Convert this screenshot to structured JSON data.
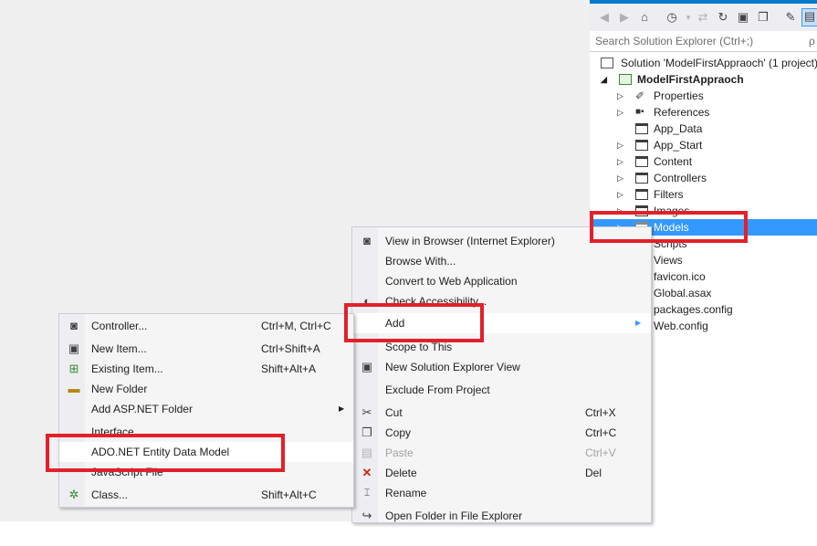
{
  "solution_explorer": {
    "search_placeholder": "Search Solution Explorer (Ctrl+;)",
    "search_arrow": "ρ",
    "toolbar_icons": [
      "back-icon",
      "forward-icon",
      "home-icon",
      "history-icon",
      "sync-icon",
      "refresh-icon",
      "collapse-all-icon",
      "copy-icon",
      "properties-icon",
      "preview-icon"
    ],
    "tree": {
      "solution": "Solution 'ModelFirstAppraoch' (1 project)",
      "project": "ModelFirstAppraoch",
      "items": [
        "Properties",
        "References",
        "App_Data",
        "App_Start",
        "Content",
        "Controllers",
        "Filters",
        "Images",
        "Models",
        "Scripts",
        "Views",
        "favicon.ico",
        "Global.asax",
        "packages.config",
        "Web.config"
      ]
    }
  },
  "context_menu": {
    "items": [
      {
        "label": "View in Browser (Internet Explorer)",
        "shortcut": ""
      },
      {
        "label": "Browse With...",
        "shortcut": ""
      },
      {
        "label": "Convert to Web Application",
        "shortcut": ""
      },
      {
        "label": "Check Accessibility...",
        "shortcut": ""
      },
      {
        "label": "Add",
        "shortcut": ""
      },
      {
        "label": "Scope to This",
        "shortcut": ""
      },
      {
        "label": "New Solution Explorer View",
        "shortcut": ""
      },
      {
        "label": "Exclude From Project",
        "shortcut": ""
      },
      {
        "label": "Cut",
        "shortcut": "Ctrl+X"
      },
      {
        "label": "Copy",
        "shortcut": "Ctrl+C"
      },
      {
        "label": "Paste",
        "shortcut": "Ctrl+V"
      },
      {
        "label": "Delete",
        "shortcut": "Del"
      },
      {
        "label": "Rename",
        "shortcut": ""
      },
      {
        "label": "Open Folder in File Explorer",
        "shortcut": ""
      }
    ]
  },
  "add_submenu": {
    "items": [
      {
        "label": "Controller...",
        "shortcut": "Ctrl+M, Ctrl+C"
      },
      {
        "label": "New Item...",
        "shortcut": "Ctrl+Shift+A"
      },
      {
        "label": "Existing Item...",
        "shortcut": "Shift+Alt+A"
      },
      {
        "label": "New Folder",
        "shortcut": ""
      },
      {
        "label": "Add ASP.NET Folder",
        "shortcut": ""
      },
      {
        "label": "Interface",
        "shortcut": ""
      },
      {
        "label": "ADO.NET Entity Data Model",
        "shortcut": ""
      },
      {
        "label": "JavaScript File",
        "shortcut": ""
      },
      {
        "label": "Class...",
        "shortcut": "Shift+Alt+C"
      }
    ]
  },
  "colors": {
    "accent": "#007acc",
    "selection": "#3399ff",
    "highlight_box": "#e3202a",
    "menu_background": "#f5f5f5"
  }
}
